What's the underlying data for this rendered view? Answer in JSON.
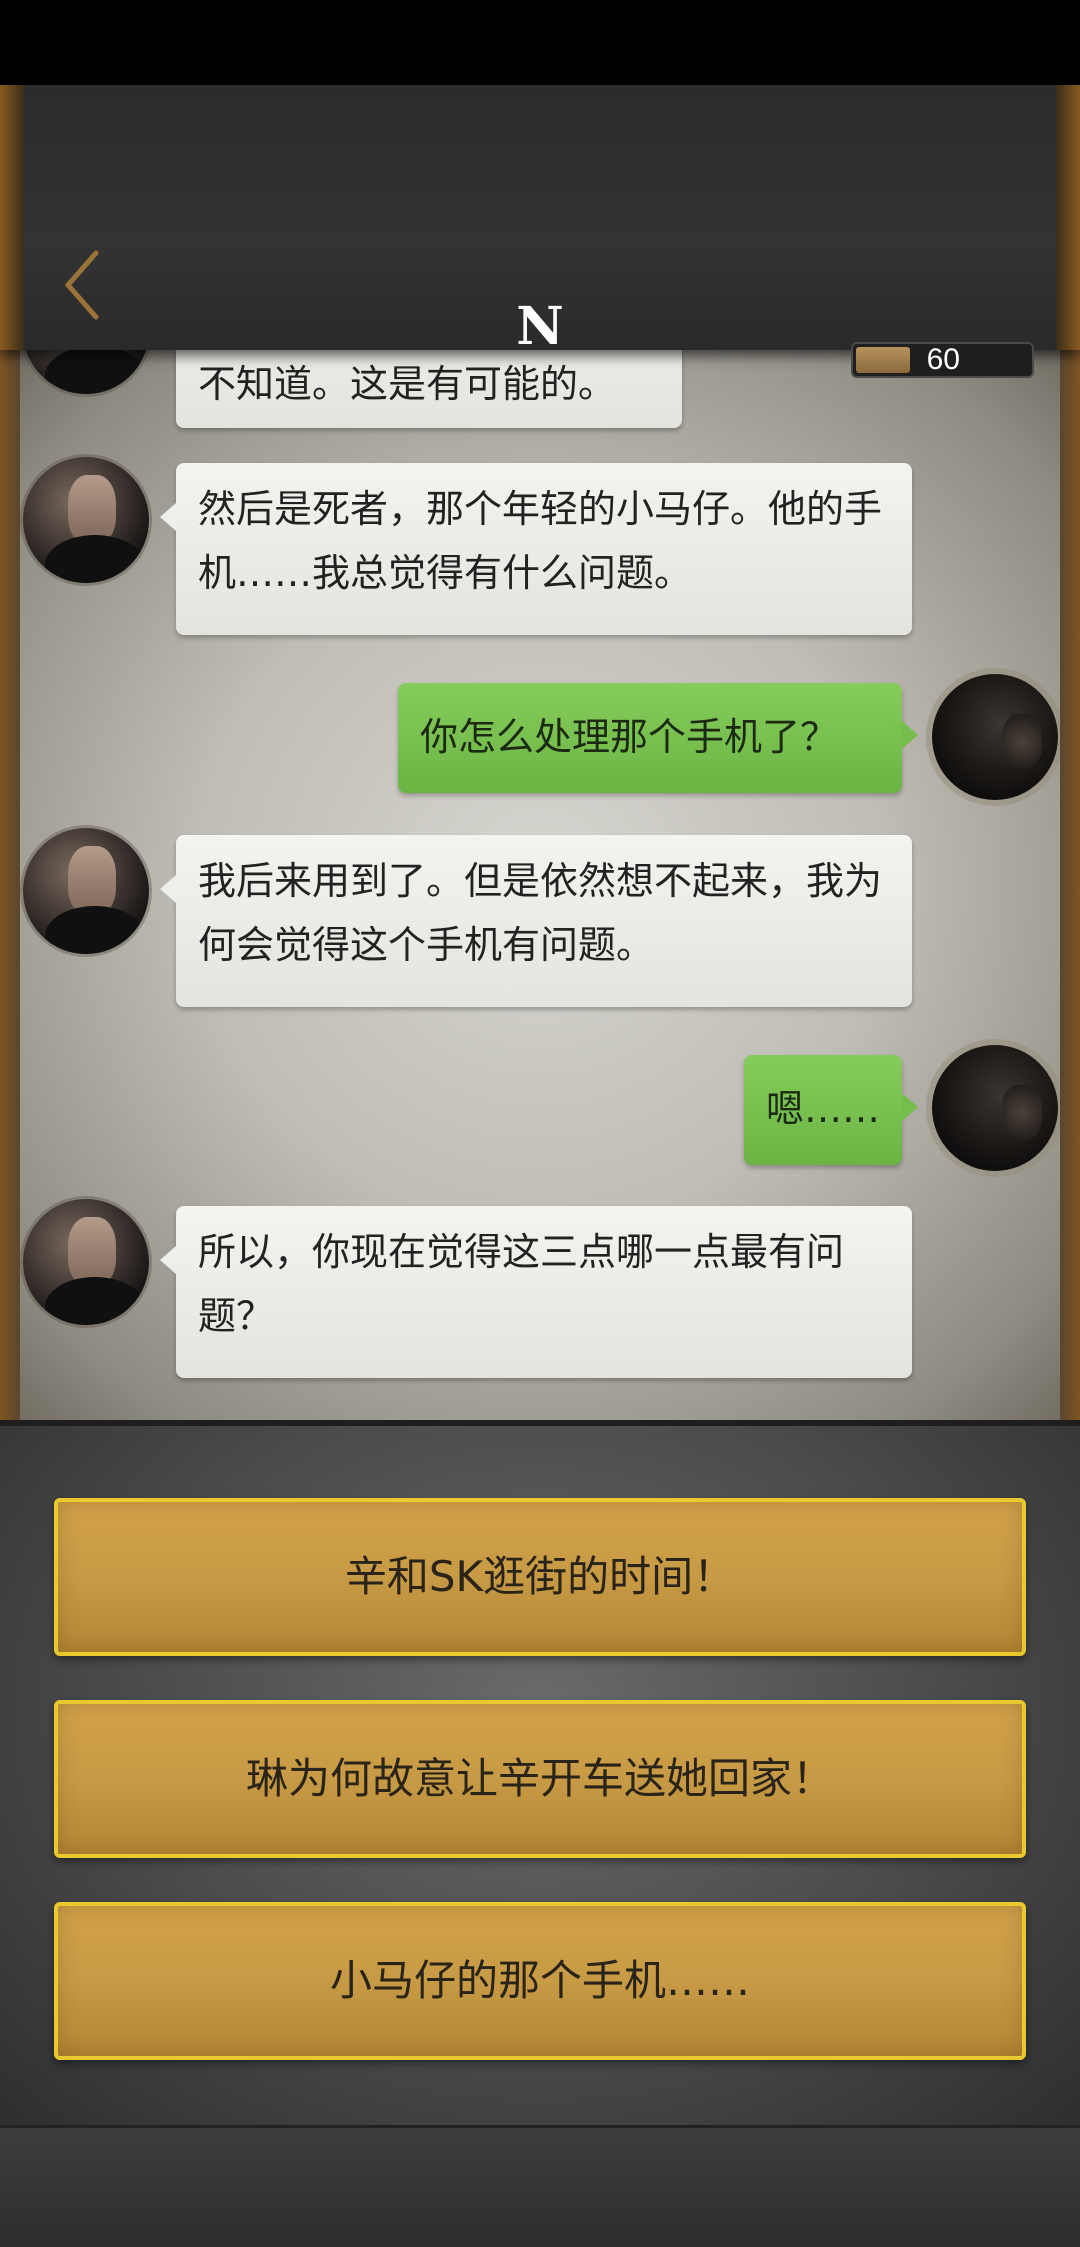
{
  "header": {
    "title": "N",
    "counter_value": "60",
    "counter_fill_fraction": 0.3
  },
  "messages": [
    {
      "side": "left",
      "text": "不知道。这是有可能的。"
    },
    {
      "side": "left",
      "text": "然后是死者，那个年轻的小马仔。他的手机……我总觉得有什么问题。"
    },
    {
      "side": "right",
      "text": "你怎么处理那个手机了？"
    },
    {
      "side": "left",
      "text": "我后来用到了。但是依然想不起来，我为何会觉得这个手机有问题。"
    },
    {
      "side": "right",
      "text": "嗯……"
    },
    {
      "side": "left",
      "text": "所以，你现在觉得这三点哪一点最有问题？"
    }
  ],
  "options": [
    {
      "label": "辛和SK逛街的时间！"
    },
    {
      "label": "琳为何故意让辛开车送她回家！"
    },
    {
      "label": "小马仔的那个手机……"
    }
  ],
  "colors": {
    "accent_gold": "#e9c92d",
    "option_fill": "#c79a45",
    "bubble_green": "#77bd4d",
    "bubble_white": "#eeeeea"
  },
  "icons": {
    "back": "chevron-left-icon"
  }
}
